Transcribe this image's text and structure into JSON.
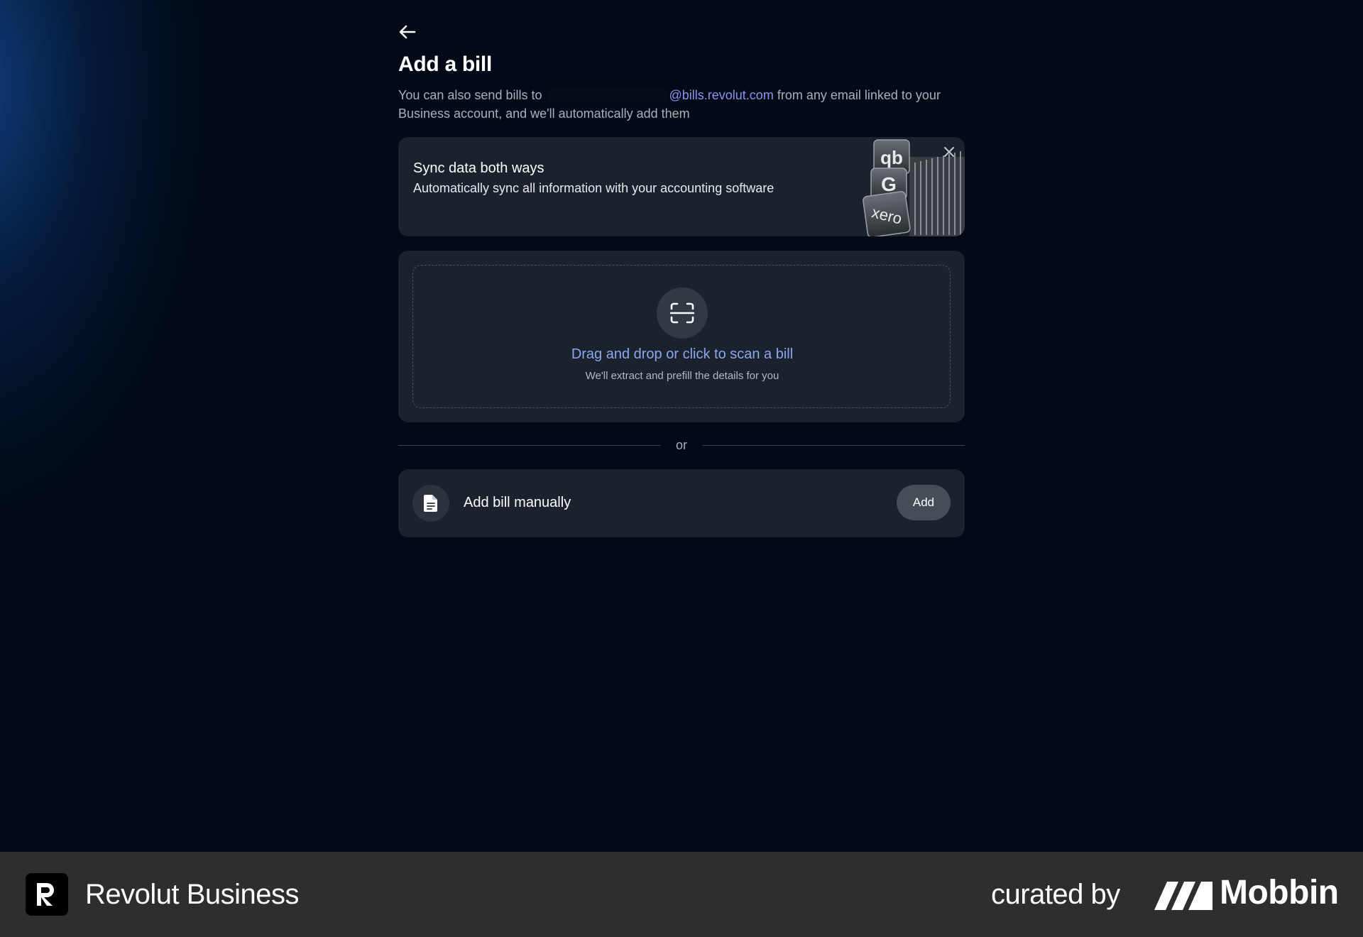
{
  "header": {
    "back_icon": "arrow-left-icon",
    "title": "Add a bill",
    "subtitle_before": "You can also send bills to",
    "subtitle_email_domain": "@bills.revolut.com",
    "subtitle_after": "from any email linked to your Business account, and we'll automatically add them"
  },
  "sync_card": {
    "title": "Sync data both ways",
    "description": "Automatically sync all information with your accounting software",
    "illustration_labels": [
      "qb",
      "G",
      "xero"
    ],
    "close_icon": "close-icon"
  },
  "scan_card": {
    "icon": "scan-icon",
    "title": "Drag and drop or click to scan a bill",
    "subtitle": "We'll extract and prefill the details for you"
  },
  "divider": {
    "text": "or"
  },
  "manual_card": {
    "icon": "document-icon",
    "label": "Add bill manually",
    "button_label": "Add"
  },
  "footer": {
    "brand": "Revolut Business",
    "curated": "curated by",
    "mobbin": "Mobbin"
  },
  "colors": {
    "background": "#010a16",
    "card": "#1c222d",
    "link": "#8c93ef",
    "scan_link": "#8aa8ef",
    "button": "#454d57",
    "footer": "#2e2e2e"
  }
}
